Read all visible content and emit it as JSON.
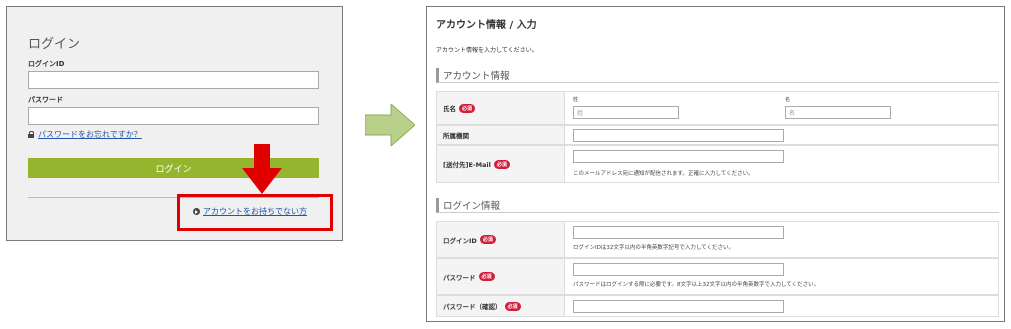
{
  "login": {
    "title": "ログイン",
    "id_label": "ログインID",
    "password_label": "パスワード",
    "forgot_link": "パスワードをお忘れですか？",
    "login_button": "ログイン",
    "no_account_link": "アカウントをお持ちでない方"
  },
  "form": {
    "title": "アカウント情報 / 入力",
    "description": "アカウント情報を入力してください。",
    "account_section": {
      "heading": "アカウント情報",
      "rows": {
        "name": {
          "label": "氏名",
          "required": "必須",
          "last_sub": "姓",
          "last_placeholder": "姓",
          "first_sub": "名",
          "first_placeholder": "名"
        },
        "affiliation": {
          "label": "所属機関"
        },
        "email": {
          "label": "[送付先]E-Mail",
          "required": "必須",
          "note": "このメールアドレス宛に通知が配信されます。正確に入力してください。"
        }
      }
    },
    "login_section": {
      "heading": "ログイン情報",
      "rows": {
        "login_id": {
          "label": "ログインID",
          "required": "必須",
          "note": "ログインIDは32文字以内の半角英数字記号で入力してください。"
        },
        "password": {
          "label": "パスワード",
          "required": "必須",
          "note": "パスワードはログインする際に必要です。8文字以上32文字以内の半角英数字で入力してください。"
        },
        "password_confirm": {
          "label": "パスワード（確認）",
          "required": "必須"
        }
      }
    }
  },
  "colors": {
    "login_button": "#95b52f",
    "highlight_border": "#e00000",
    "required_badge": "#d21e3c",
    "transition_arrow": "#b9d08a",
    "pointer_arrow": "#e00000"
  }
}
